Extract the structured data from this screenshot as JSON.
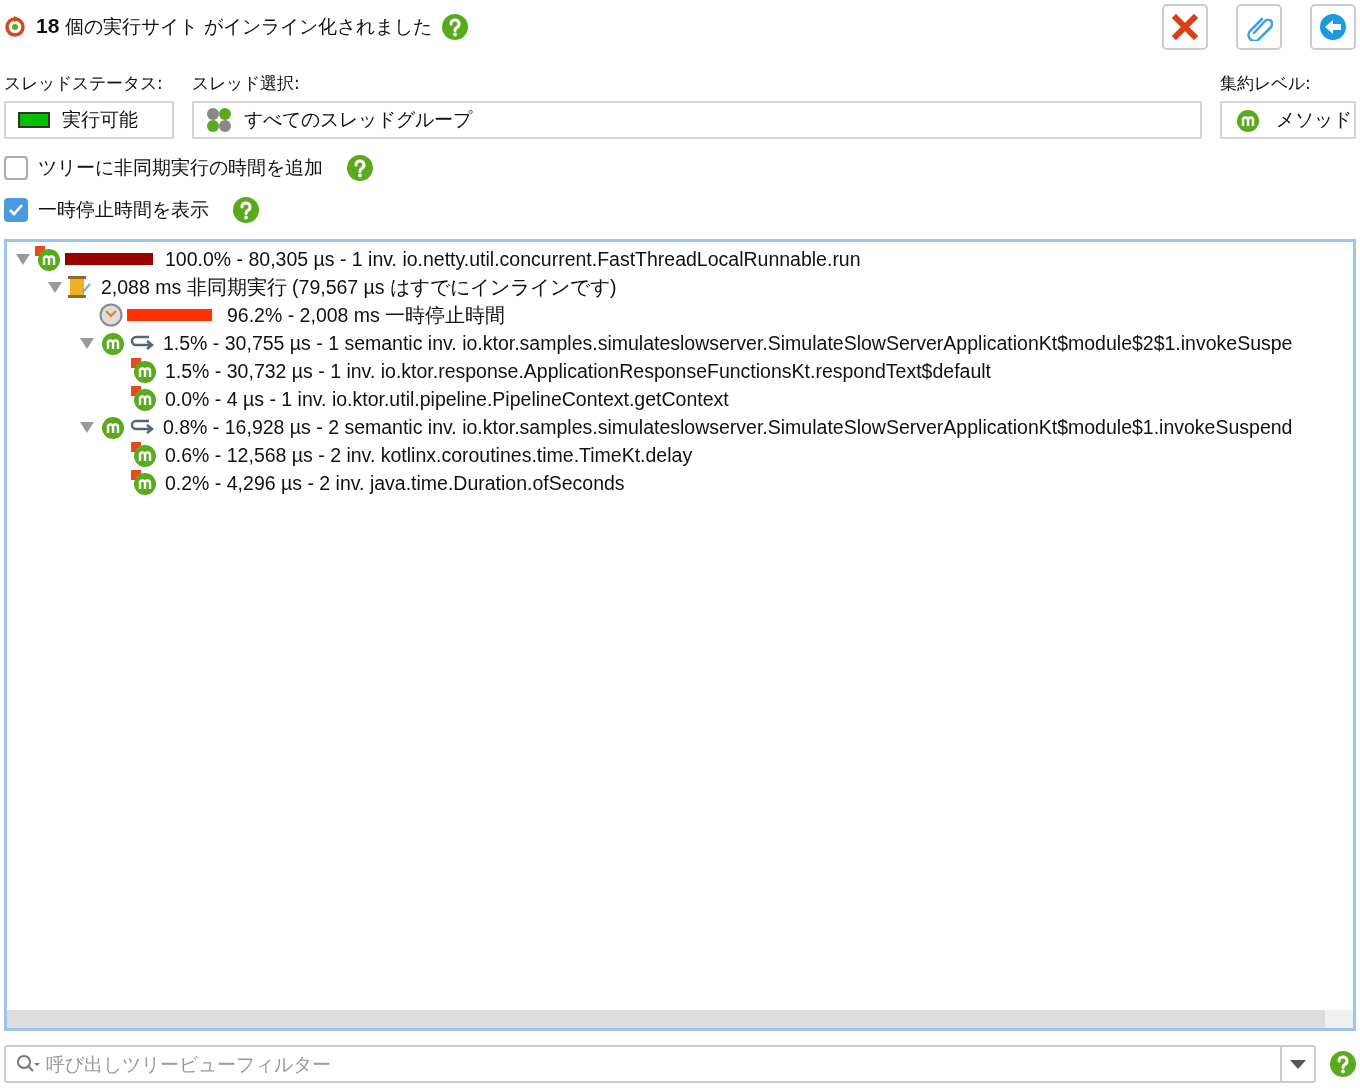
{
  "header": {
    "title": "**18** 個の実行サイト がインライン化されました",
    "buttons": [
      {
        "kind": "close"
      },
      {
        "kind": "attach"
      },
      {
        "kind": "back"
      }
    ]
  },
  "thread_status": {
    "label": "スレッドステータス:",
    "value": "実行可能",
    "color": "#00c000"
  },
  "thread_selection": {
    "label": "スレッド選択:",
    "value": "すべてのスレッドグループ"
  },
  "aggregation_level": {
    "label": "集約レベル:",
    "value": "メソッド"
  },
  "options": [
    {
      "label": "ツリーに非同期実行の時間を追加",
      "checked": false
    },
    {
      "label": "一時停止時間を表示",
      "checked": true
    }
  ],
  "tree": [
    {
      "kind": "method",
      "expanded": true,
      "level": 1.0,
      "color": "#990000",
      "text": "100.0% - 80,305 µs - 1 inv. io.netty.util.concurrent.FastThreadLocalRunnable.run",
      "children": [
        {
          "kind": "async",
          "expanded": true,
          "text": "2,088 ms 非同期実行 (79,567 µs はすでにインラインです)",
          "children": [
            {
              "kind": "wait",
              "level": 0.962,
              "color": "#ff3300",
              "text": "96.2% - 2,008 ms 一時停止時間"
            },
            {
              "kind": "semantic",
              "expanded": true,
              "text": "1.5% - 30,755 µs - 1 semantic inv. io.ktor.samples.simulateslowserver.SimulateSlowServerApplicationKt$module$2$1.invokeSuspe",
              "children": [
                {
                  "kind": "method",
                  "text": "1.5% - 30,732 µs - 1 inv. io.ktor.response.ApplicationResponseFunctionsKt.respondText$default"
                },
                {
                  "kind": "method",
                  "text": "0.0% - 4 µs - 1 inv. io.ktor.util.pipeline.PipelineContext.getContext"
                }
              ]
            },
            {
              "kind": "semantic",
              "expanded": true,
              "text": "0.8% - 16,928 µs - 2 semantic inv. io.ktor.samples.simulateslowserver.SimulateSlowServerApplicationKt$module$1.invokeSuspend",
              "children": [
                {
                  "kind": "method",
                  "text": "0.6% - 12,568 µs - 2 inv. kotlinx.coroutines.time.TimeKt.delay"
                },
                {
                  "kind": "method",
                  "text": "0.2% - 4,296 µs - 2 inv. java.time.Duration.ofSeconds"
                }
              ]
            }
          ]
        }
      ]
    }
  ],
  "filter": {
    "placeholder": "呼び出しツリービューフィルター"
  }
}
